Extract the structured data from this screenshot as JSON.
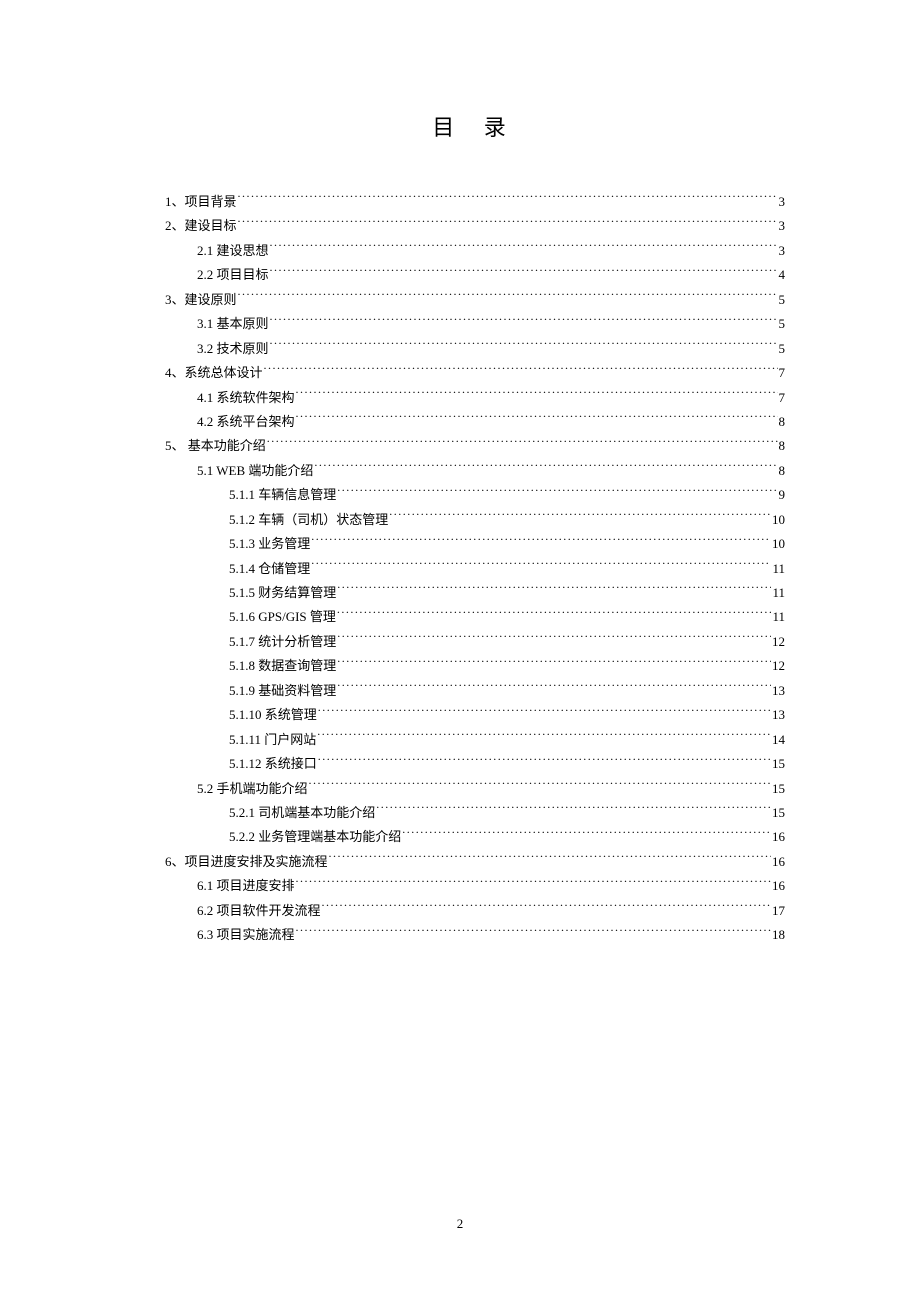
{
  "title": "目 录",
  "page_number": "2",
  "entries": [
    {
      "indent": 0,
      "label": "1、项目背景",
      "page": "3"
    },
    {
      "indent": 0,
      "label": "2、建设目标",
      "page": "3"
    },
    {
      "indent": 1,
      "label": "2.1 建设思想",
      "page": "3"
    },
    {
      "indent": 1,
      "label": "2.2 项目目标",
      "page": "4"
    },
    {
      "indent": 0,
      "label": "3、建设原则",
      "page": "5"
    },
    {
      "indent": 1,
      "label": "3.1 基本原则",
      "page": "5"
    },
    {
      "indent": 1,
      "label": "3.2 技术原则",
      "page": "5"
    },
    {
      "indent": 0,
      "label": "4、系统总体设计",
      "page": "7"
    },
    {
      "indent": 1,
      "label": "4.1 系统软件架构",
      "page": "7"
    },
    {
      "indent": 1,
      "label": "4.2 系统平台架构",
      "page": "8"
    },
    {
      "indent": 0,
      "label": "5、 基本功能介绍",
      "page": "8"
    },
    {
      "indent": 1,
      "label": "5.1 WEB 端功能介绍",
      "page": "8"
    },
    {
      "indent": 2,
      "label": "5.1.1 车辆信息管理",
      "page": "9"
    },
    {
      "indent": 2,
      "label": "5.1.2 车辆（司机）状态管理",
      "page": "10"
    },
    {
      "indent": 2,
      "label": "5.1.3 业务管理",
      "page": "10"
    },
    {
      "indent": 2,
      "label": "5.1.4 仓储管理",
      "page": "11"
    },
    {
      "indent": 2,
      "label": "5.1.5 财务结算管理",
      "page": "11"
    },
    {
      "indent": 2,
      "label": "5.1.6 GPS/GIS 管理",
      "page": "11"
    },
    {
      "indent": 2,
      "label": "5.1.7 统计分析管理",
      "page": "12"
    },
    {
      "indent": 2,
      "label": "5.1.8 数据查询管理",
      "page": "12"
    },
    {
      "indent": 2,
      "label": "5.1.9 基础资料管理",
      "page": "13"
    },
    {
      "indent": 2,
      "label": "5.1.10 系统管理",
      "page": "13"
    },
    {
      "indent": 2,
      "label": "5.1.11 门户网站",
      "page": "14"
    },
    {
      "indent": 2,
      "label": "5.1.12 系统接口",
      "page": "15"
    },
    {
      "indent": 1,
      "label": "5.2 手机端功能介绍",
      "page": "15"
    },
    {
      "indent": 2,
      "label": "5.2.1 司机端基本功能介绍",
      "page": "15"
    },
    {
      "indent": 2,
      "label": "5.2.2 业务管理端基本功能介绍",
      "page": "16"
    },
    {
      "indent": 0,
      "label": "6、项目进度安排及实施流程",
      "page": "16"
    },
    {
      "indent": 1,
      "label": "6.1 项目进度安排",
      "page": "16"
    },
    {
      "indent": 1,
      "label": "6.2 项目软件开发流程",
      "page": "17"
    },
    {
      "indent": 1,
      "label": "6.3 项目实施流程",
      "page": "18"
    }
  ]
}
